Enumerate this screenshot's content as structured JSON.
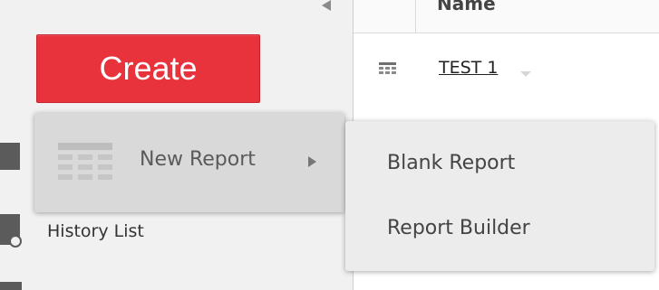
{
  "sidebar": {
    "create_label": "Create",
    "history_label": "History List",
    "icons": [
      "people-icon",
      "history-icon",
      "clock-icon"
    ]
  },
  "grid": {
    "header_label": "Name",
    "rows": [
      {
        "name": "TEST 1",
        "icon": "report-grid-icon"
      }
    ]
  },
  "create_menu": {
    "items": [
      {
        "label": "New Report",
        "icon": "report-table-icon",
        "has_submenu": true
      }
    ]
  },
  "submenu": {
    "items": [
      {
        "label": "Blank Report"
      },
      {
        "label": "Report Builder"
      }
    ]
  },
  "colors": {
    "create_button": "#e8323c",
    "menu_background": "#ececec",
    "menu_highlight": "#d9d9d9",
    "sidebar_background": "#f1f1f1"
  }
}
